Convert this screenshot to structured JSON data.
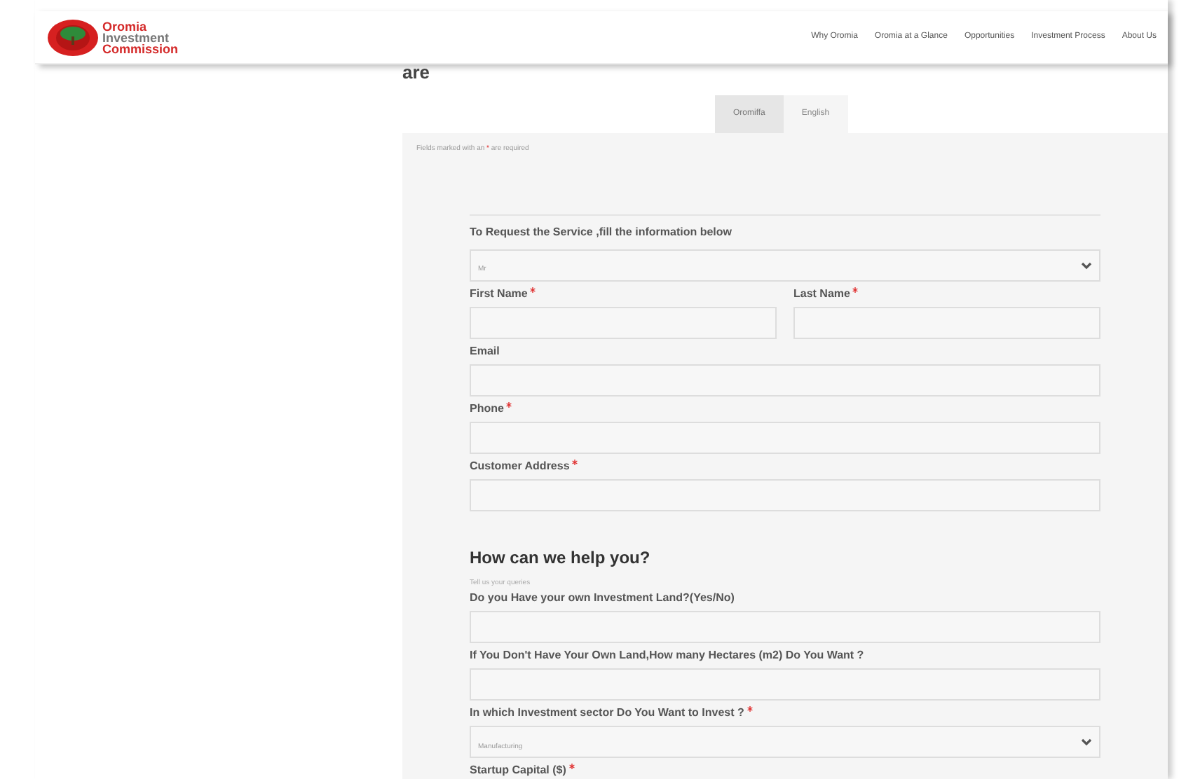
{
  "logo": {
    "lines": [
      {
        "text": "Oromia",
        "color": "#d42a2a"
      },
      {
        "text": "Investment",
        "color": "#777777"
      },
      {
        "text": "Commission",
        "color": "#d42a2a"
      }
    ]
  },
  "nav": [
    "Why Oromia",
    "Oromia at a Glance",
    "Opportunities",
    "Investment Process",
    "About Us"
  ],
  "page_heading": "are",
  "tabs": [
    {
      "label": "Oromiffa",
      "selected": false
    },
    {
      "label": "English",
      "selected": true
    }
  ],
  "notice": {
    "before": "Fields marked with an",
    "mark": "*",
    "after": "are required"
  },
  "intro": "To Request the Service ,fill the information below",
  "section1": [
    {
      "kind": "select",
      "value": "Mr"
    },
    {
      "kind": "pair",
      "fields": [
        {
          "label": "First Name",
          "required": true
        },
        {
          "label": "Last Name",
          "required": true
        }
      ]
    },
    {
      "kind": "input",
      "label": "Email",
      "required": false
    },
    {
      "kind": "input",
      "label": "Phone",
      "required": true
    },
    {
      "kind": "input",
      "label": "Customer Address",
      "required": true
    }
  ],
  "help_heading": "How can we help you?",
  "help_hint": "Tell us your queries",
  "section2": [
    {
      "kind": "input",
      "label": "Do you Have your own Investment Land?(Yes/No)",
      "required": false
    },
    {
      "kind": "input",
      "label": "If You Don't Have Your Own Land,How many Hectares (m2) Do You Want ?",
      "required": false
    },
    {
      "kind": "select",
      "label": "In which Investment sector Do You Want to Invest ?",
      "required": true,
      "value": "Manufacturing"
    },
    {
      "kind": "label",
      "label": "Startup Capital ($)",
      "required": true
    }
  ]
}
